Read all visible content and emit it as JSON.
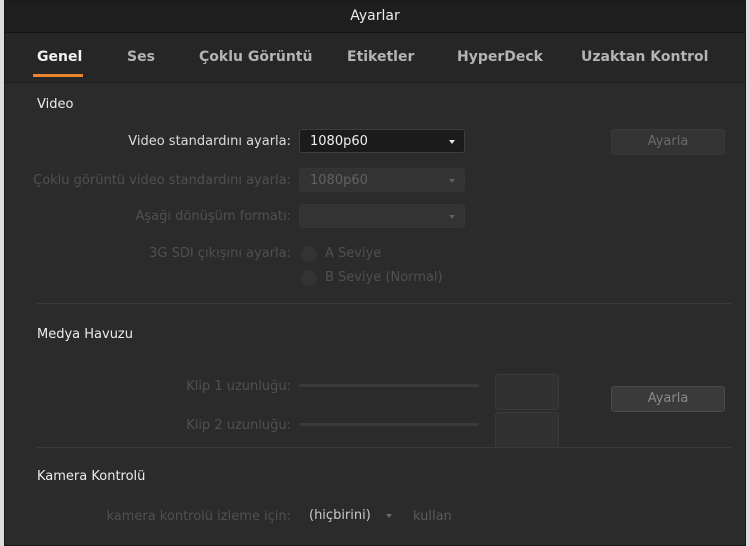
{
  "window": {
    "title": "Ayarlar"
  },
  "tabs": [
    {
      "label": "Genel"
    },
    {
      "label": "Ses"
    },
    {
      "label": "Çoklu Görüntü"
    },
    {
      "label": "Etiketler"
    },
    {
      "label": "HyperDeck"
    },
    {
      "label": "Uzaktan Kontrol"
    }
  ],
  "video": {
    "title": "Video",
    "standard_label": "Video standardını ayarla:",
    "standard_value": "1080p60",
    "apply_button": "Ayarla",
    "multiview_label": "Çoklu görüntü video standardını ayarla:",
    "multiview_value": "1080p60",
    "downconvert_label": "Aşağı dönüşüm formatı:",
    "downconvert_value": "",
    "sdi_label": "3G SDI çıkışını ayarla:",
    "sdi_options": [
      "A Seviye",
      "B Seviye (Normal)"
    ]
  },
  "media_pool": {
    "title": "Medya Havuzu",
    "clip1_label": "Klip 1 uzunluğu:",
    "clip2_label": "Klip 2 uzunluğu:",
    "apply_button": "Ayarla"
  },
  "camera_control": {
    "title": "Kamera Kontrolü",
    "monitor_label": "kamera kontrolü izleme için:",
    "monitor_value": "(hiçbirini)",
    "suffix": "kullan"
  }
}
